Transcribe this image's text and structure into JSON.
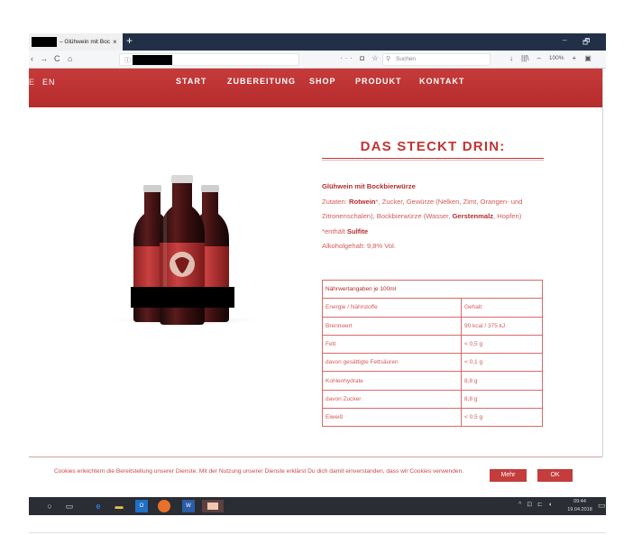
{
  "browser": {
    "tab_title": "– Glühwein mit Bock",
    "tab_close": "×",
    "new_tab": "+",
    "win_minimize": "–",
    "win_maximize": "🗗",
    "back": "‹",
    "forward": "→",
    "reload": "C",
    "home": "⌂",
    "page_actions": "··· ◘ ☆",
    "search_placeholder": "Suchen",
    "download": "↓",
    "library": "|||\\",
    "zoom_out": "–",
    "zoom": "100%",
    "zoom_in": "+",
    "sidebar": "▣"
  },
  "site": {
    "lang_de": "E",
    "lang_en": "EN",
    "nav": {
      "start": "START",
      "zubereitung": "ZUBEREITUNG",
      "shop": "SHOP",
      "produkt": "PRODUKT",
      "kontakt": "KONTAKT"
    }
  },
  "product": {
    "heading": "DAS STECKT DRIN:",
    "name": "Glühwein mit Bockbierwürze",
    "ingredients_prefix": "Zutaten: ",
    "ingredients_rotwein": "Rotwein",
    "ingredients_mid": "*, Zucker, Gewürze (Nelken, Zimt, Orangen- und Zitronenschalen), Bockbierwürze (Wasser, ",
    "ingredients_gerste": "Gerstenmalz",
    "ingredients_end": ", Hopfen)",
    "sulfite_prefix": "*enthält ",
    "sulfite": "Sulfite",
    "alcohol": "Alkoholgehalt: 9,8% Vol."
  },
  "nutrition": {
    "title": "Nährwertangaben je 100ml",
    "rows": [
      {
        "label": "Energie / Nährstoffe",
        "value": "Gehalt"
      },
      {
        "label": "Brennwert",
        "value": "90 kcal / 375 kJ"
      },
      {
        "label": "Fett",
        "value": "< 0,5 g"
      },
      {
        "label": "davon gesättigte Fettsäuren",
        "value": "< 0,1 g"
      },
      {
        "label": "Kohlenhydrate",
        "value": "8,8 g"
      },
      {
        "label": "davon Zucker",
        "value": "8,8 g"
      },
      {
        "label": "Eiweiß",
        "value": "< 0,5 g"
      }
    ]
  },
  "cookie": {
    "text": "Cookies erleichtern die Bereitstellung unserer Dienste. Mit der Nutzung unserer Dienste erklärst Du dich damit einverstanden, dass wir Cookies verwenden.",
    "more_label": "Mehr",
    "ok_label": "OK"
  },
  "taskbar": {
    "outlook": "O",
    "word": "W",
    "systray": "^ ⊡ ⊏ ◖",
    "time": "09:44",
    "date": "19.04.2018",
    "notifications": "▭"
  },
  "colors": {
    "brand_red": "#c03434",
    "text_red": "#d45a5a"
  }
}
